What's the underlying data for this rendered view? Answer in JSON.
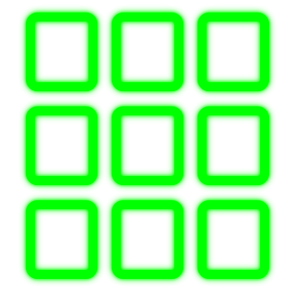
{
  "icon": {
    "name": "grid-icon",
    "rows": 3,
    "columns": 3,
    "stroke_color": "#00ff00",
    "glow_color": "#00ff00",
    "background_color": "#ffffff"
  }
}
